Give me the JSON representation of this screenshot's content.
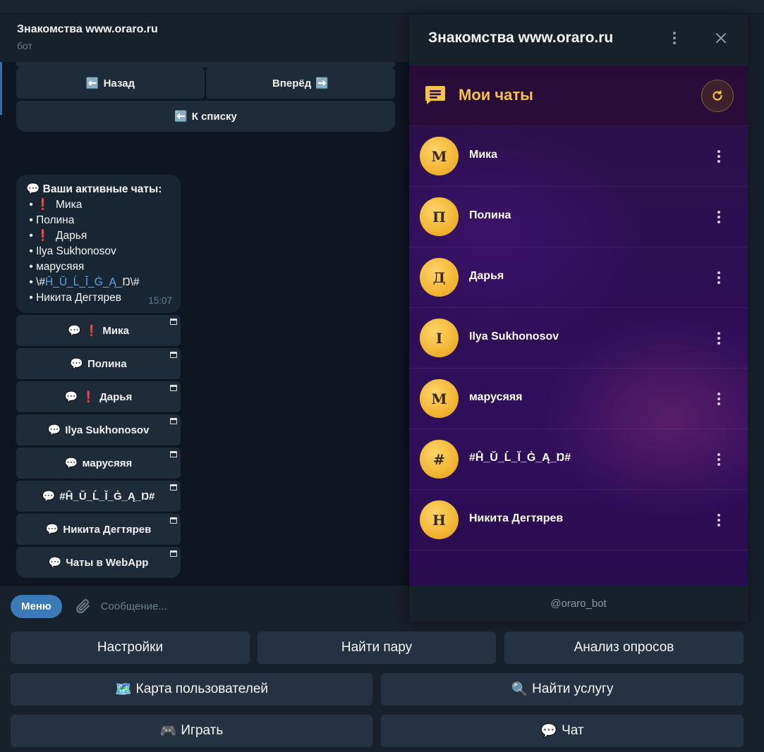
{
  "chat": {
    "title": "Знакомства www.oraro.ru",
    "subtitle": "бот"
  },
  "nav_buttons": {
    "back": {
      "emoji": "⬅️",
      "label": "Назад"
    },
    "forward": {
      "label": "Вперёд",
      "emoji": "➡️"
    },
    "to_list": {
      "emoji": "⬅️",
      "label": "К списку"
    }
  },
  "message": {
    "header_emoji": "💬",
    "header": "Ваши активные чаты:",
    "bullet": "•",
    "alert_emoji": "❗",
    "lines": [
      "Мика",
      "Полина",
      "Дарья",
      "Ilya Sukhonosov",
      "марусяяя",
      "\\#",
      "Ĥ_Ŭ_Ĺ_Ĭ_Ġ_Ą_",
      "Ŋ\\#",
      "Никита Дегтярев"
    ],
    "time": "15:07"
  },
  "chat_buttons": [
    {
      "label": "Мика",
      "icon": "💬",
      "alert": "❗"
    },
    {
      "label": "Полина",
      "icon": "💬"
    },
    {
      "label": "Дарья",
      "icon": "💬",
      "alert": "❗"
    },
    {
      "label": "Ilya Sukhonosov",
      "icon": "💬"
    },
    {
      "label": "марусяяя",
      "icon": "💬"
    },
    {
      "label": "#Ĥ_Ŭ_Ĺ_Ĭ_Ġ_Ą_Ŋ#",
      "icon": "💬"
    },
    {
      "label": "Никита Дегтярев",
      "icon": "💬"
    },
    {
      "label": "Чаты в WebApp",
      "icon": "💬"
    }
  ],
  "composer": {
    "menu_label": "Меню",
    "placeholder": "Сообщение..."
  },
  "reply_keyboard": {
    "settings": "Настройки",
    "find_pair": "Найти пару",
    "poll_analysis": "Анализ опросов",
    "user_map": "Карта пользователей",
    "user_map_emoji": "🗺️",
    "find_service": "Найти услугу",
    "find_service_emoji": "🔍",
    "play": "Играть",
    "play_emoji": "🎮",
    "chat": "Чат",
    "chat_emoji": "💬"
  },
  "webapp": {
    "title": "Знакомства www.oraro.ru",
    "heading": "Мои чаты",
    "footer": "@oraro_bot",
    "accent_color": "#f6c34a",
    "chats": [
      {
        "initial": "М",
        "name": "Мика"
      },
      {
        "initial": "П",
        "name": "Полина"
      },
      {
        "initial": "Д",
        "name": "Дарья"
      },
      {
        "initial": "I",
        "name": "Ilya Sukhonosov"
      },
      {
        "initial": "М",
        "name": "марусяяя"
      },
      {
        "initial": "#",
        "name": "#Ĥ_Ŭ_Ĺ_Ĭ_Ġ_Ą_Ŋ#"
      },
      {
        "initial": "Н",
        "name": "Никита Дегтярев"
      }
    ]
  }
}
